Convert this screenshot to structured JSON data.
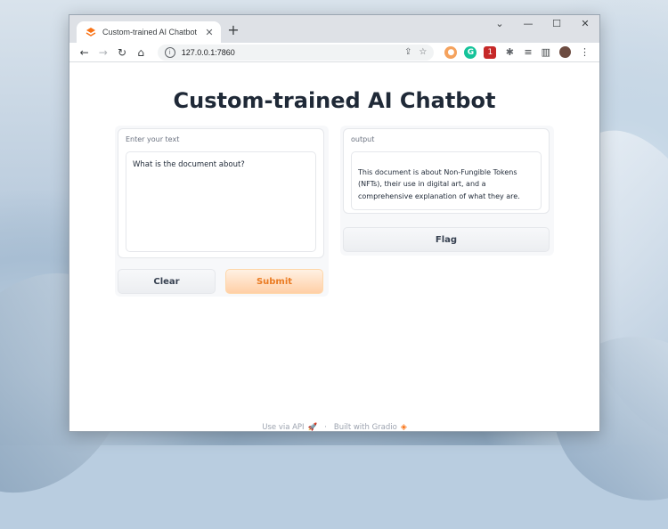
{
  "browser": {
    "tab_title": "Custom-trained AI Chatbot",
    "tab_close": "✕",
    "new_tab": "+",
    "url": "127.0.0.1:7860",
    "window_controls": {
      "chevron": "⌄",
      "minimize": "—",
      "maximize": "☐",
      "close": "✕"
    },
    "extension_badge": "1"
  },
  "page": {
    "title": "Custom-trained AI Chatbot",
    "input": {
      "label": "Enter your text",
      "value": "What is the document about?"
    },
    "output": {
      "label": "output",
      "value": "This document is about Non-Fungible Tokens (NFTs), their use in digital art, and a comprehensive explanation of what they are."
    },
    "buttons": {
      "clear": "Clear",
      "submit": "Submit",
      "flag": "Flag"
    },
    "footer": {
      "api_link": "Use via API",
      "separator": "·",
      "built_with": "Built with Gradio"
    }
  },
  "colors": {
    "accent": "#ea7b22",
    "submit_bg": "#ffcfa6",
    "title": "#1f2937"
  }
}
